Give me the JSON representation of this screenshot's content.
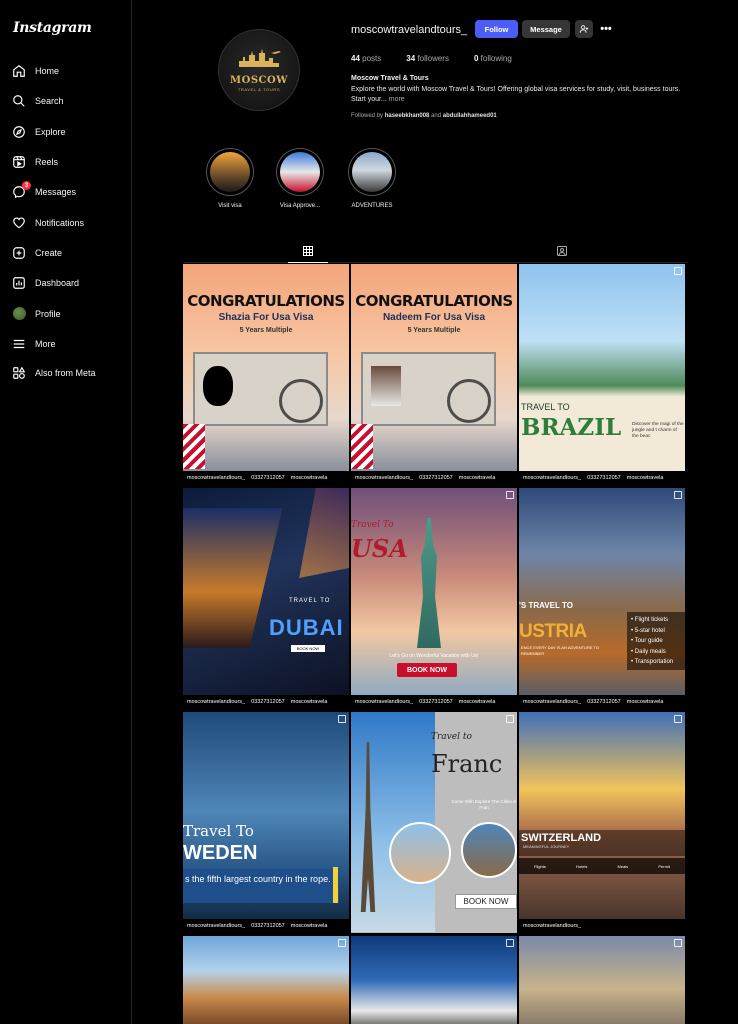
{
  "app": {
    "logo": "Instagram"
  },
  "sidebar": {
    "items": [
      {
        "label": "Home",
        "icon": "home-icon"
      },
      {
        "label": "Search",
        "icon": "search-icon"
      },
      {
        "label": "Explore",
        "icon": "compass-icon"
      },
      {
        "label": "Reels",
        "icon": "reels-icon"
      },
      {
        "label": "Messages",
        "icon": "messenger-icon",
        "badge": "3"
      },
      {
        "label": "Notifications",
        "icon": "heart-icon"
      },
      {
        "label": "Create",
        "icon": "plus-square-icon"
      },
      {
        "label": "Dashboard",
        "icon": "chart-icon"
      },
      {
        "label": "Profile",
        "icon": "avatar"
      },
      {
        "label": "More",
        "icon": "menu-icon"
      }
    ],
    "meta": {
      "label": "Also from Meta",
      "icon": "meta-apps-icon"
    }
  },
  "profile": {
    "username": "moscowtravelandtours_",
    "avatar_brand": "MOSCOW",
    "avatar_sub": "TRAVEL & TOURS",
    "buttons": {
      "follow": "Follow",
      "message": "Message",
      "more": "•••"
    },
    "stats": {
      "posts_count": "44",
      "posts_label": "posts",
      "followers_count": "34",
      "followers_label": "followers",
      "following_count": "0",
      "following_label": "following"
    },
    "bio_name": "Moscow Travel & Tours",
    "bio_text": "Explore the world with Moscow Travel & Tours! Offering global visa services for study, visit, business tours. Start your...",
    "bio_more": "more",
    "followed_prefix": "Followed by",
    "followed_user1": "haseebkhan008",
    "followed_and": "and",
    "followed_user2": "abdullahhameed01"
  },
  "highlights": [
    {
      "label": "Visit visa"
    },
    {
      "label": "Visa Approve..."
    },
    {
      "label": "ADVENTURES"
    }
  ],
  "tabs": {
    "posts": "grid-icon",
    "tagged": "tagged-icon"
  },
  "posts": {
    "footer_handle": "moscowtravelandtours_",
    "footer_phone": "03327312057",
    "footer_fb": "moscowtravela",
    "p1": {
      "title": "CONGRATULATIONS",
      "sub": "Shazia For Usa Visa",
      "sub2": "5 Years Multiple"
    },
    "p2": {
      "title": "CONGRATULATIONS",
      "sub": "Nadeem For Usa Visa",
      "sub2": "5 Years Multiple"
    },
    "p3": {
      "t1": "TRAVEL TO",
      "t2": "BRAZIL",
      "desc": "Discover the magi of the jungle and t charm of the beac"
    },
    "p4": {
      "t1": "TRAVEL TO",
      "t2": "DUBAI",
      "btn": "BOOK NOW"
    },
    "p5": {
      "t1": "Travel To",
      "t2": "USA",
      "sub": "Let's Go on Wonderful Vacation with Us!",
      "btn": "BOOK NOW"
    },
    "p6": {
      "t1": "'S TRAVEL TO",
      "t2": "USTRIA",
      "t3": "ENCE EVERY DAY IS AN ADVENTURE TO REMEMBER",
      "list": [
        "Flight tickets",
        "5-star hotel",
        "Tour guide",
        "Daily meals",
        "Transportation"
      ]
    },
    "p7": {
      "t1": "Travel To",
      "t2": "WEDEN",
      "bar": "s the fifth largest country in the rope."
    },
    "p8": {
      "t1": "Travel to",
      "t2": "Franc",
      "sub": "Come With Explore The Cities in Fran",
      "btn": "BOOK NOW"
    },
    "p9": {
      "t1": "SWITZERLAND",
      "t2": "MEANINGFUL JOURNEY",
      "bar": [
        "Flights",
        "Hotels",
        "Meals",
        "Permit"
      ]
    }
  },
  "colors": {
    "accent": "#4a5df9",
    "badge": "#ff3040",
    "bg": "#000000"
  }
}
